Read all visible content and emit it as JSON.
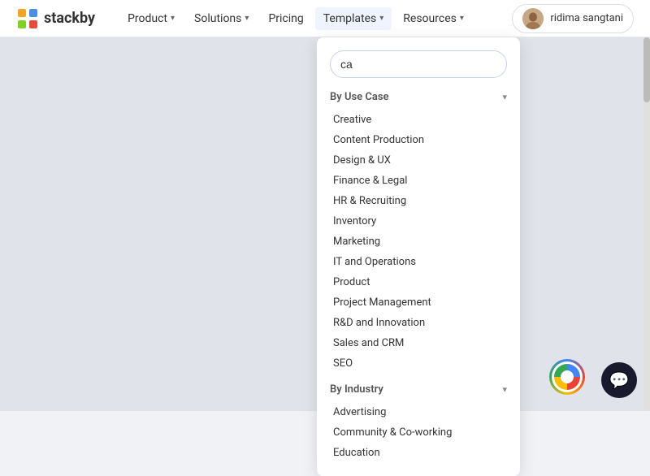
{
  "navbar": {
    "logo_text": "stackby",
    "nav_items": [
      {
        "label": "Product",
        "has_dropdown": true
      },
      {
        "label": "Solutions",
        "has_dropdown": true
      },
      {
        "label": "Pricing",
        "has_dropdown": false
      },
      {
        "label": "Templates",
        "has_dropdown": true,
        "active": true
      },
      {
        "label": "Resources",
        "has_dropdown": true
      }
    ],
    "user": {
      "name": "ridima sangtani"
    }
  },
  "dropdown": {
    "search_placeholder": "ca",
    "sections": [
      {
        "title": "By Use Case",
        "expanded": true,
        "items": [
          "Creative",
          "Content Production",
          "Design & UX",
          "Finance & Legal",
          "HR & Recruiting",
          "Inventory",
          "Marketing",
          "IT and Operations",
          "Product",
          "Project Management",
          "R&D and Innovation",
          "Sales and CRM",
          "SEO"
        ]
      },
      {
        "title": "By Industry",
        "expanded": true,
        "items": [
          "Advertising",
          "Community & Co-working",
          "Education"
        ]
      }
    ]
  }
}
